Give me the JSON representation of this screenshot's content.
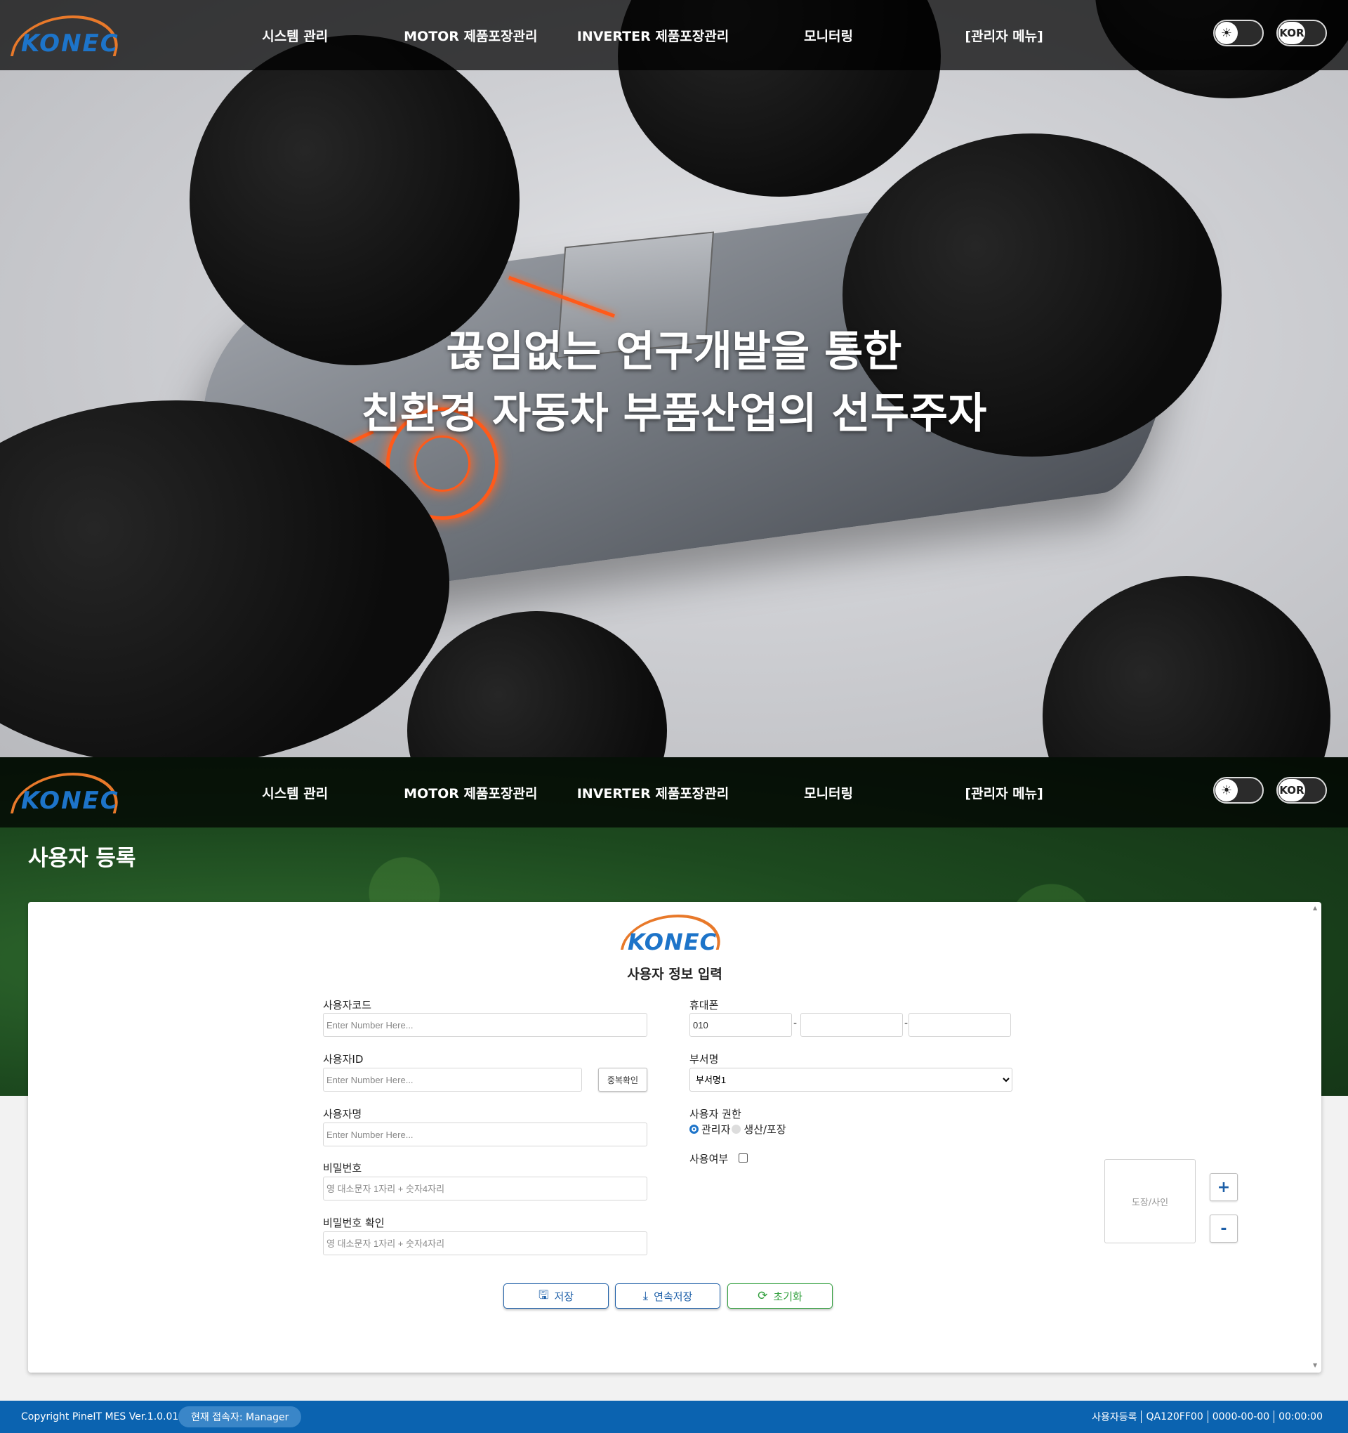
{
  "nav": {
    "logo_text": "KONEC",
    "menu": [
      "시스템 관리",
      "MOTOR 제품포장관리",
      "INVERTER 제품포장관리",
      "모니터링",
      "[관리자 메뉴]"
    ],
    "theme_icon": "sun-icon",
    "lang_label": "KOR"
  },
  "hero": {
    "line1": "끊임없는 연구개발을 통한",
    "line2": "친환경 자동차 부품산업의 선두주자"
  },
  "page": {
    "title": "사용자 등록"
  },
  "form": {
    "logo_text": "KONEC",
    "title": "사용자 정보 입력",
    "user_code": {
      "label": "사용자코드",
      "placeholder": "Enter Number Here..."
    },
    "user_id": {
      "label": "사용자ID",
      "placeholder": "Enter Number Here...",
      "check_button": "중복확인"
    },
    "user_name": {
      "label": "사용자명",
      "placeholder": "Enter Number Here..."
    },
    "password": {
      "label": "비밀번호",
      "placeholder": "영 대소문자 1자리 + 숫자4자리"
    },
    "password_confirm": {
      "label": "비밀번호 확인",
      "placeholder": "영 대소문자 1자리 + 숫자4자리"
    },
    "phone": {
      "label": "휴대폰",
      "part1": "010",
      "part2": "",
      "part3": "",
      "sep": "-"
    },
    "dept": {
      "label": "부서명",
      "selected": "부서명1"
    },
    "role": {
      "label": "사용자 권한",
      "options": [
        "관리자",
        "생산/포장"
      ],
      "selected": "관리자"
    },
    "use_yn": {
      "label": "사용여부",
      "checked": false
    },
    "stamp": {
      "label": "도장/사인",
      "plus": "+",
      "minus": "-"
    },
    "actions": {
      "save": "저장",
      "continuous_save": "연속저장",
      "reset": "초기화"
    }
  },
  "footer": {
    "copyright": "Copyright PineIT MES Ver.1.0.01",
    "current_user": "현재 접속자: Manager",
    "screen": "사용자등록",
    "code": "QA120FF00",
    "date": "0000-00-00",
    "time": "00:00:00"
  },
  "colors": {
    "brand_blue": "#1d74c9",
    "brand_orange": "#e8792a",
    "footer_blue": "#0b63b0",
    "reset_green": "#2e9e3a"
  }
}
